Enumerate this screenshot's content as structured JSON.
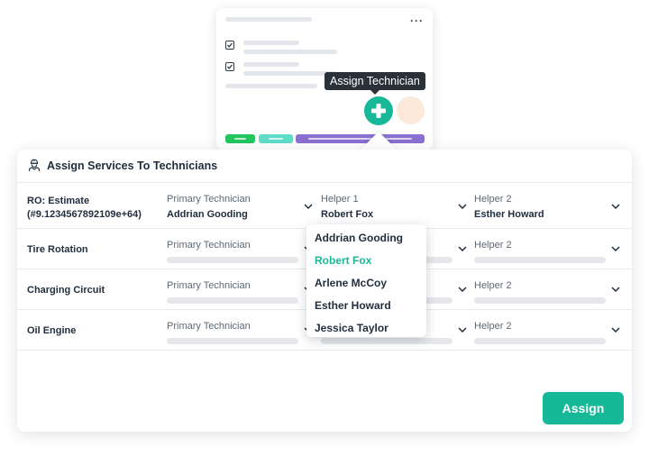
{
  "tooltip": {
    "text": "Assign Technician"
  },
  "back_card": {
    "chip_colors": [
      "#22c55e",
      "#5fdcc8",
      "#8b6fd1"
    ]
  },
  "panel": {
    "title": "Assign Services To Technicians",
    "assign_label": "Assign"
  },
  "rows": [
    {
      "service_line1": "RO: Estimate",
      "service_line2": "(#9.1234567892109e+64)",
      "primary": {
        "label": "Primary Technician",
        "value": "Addrian Gooding"
      },
      "helper1": {
        "label": "Helper 1",
        "value": "Robert Fox"
      },
      "helper2": {
        "label": "Helper 2",
        "value": "Esther Howard"
      }
    },
    {
      "service": "Tire Rotation",
      "primary": {
        "label": "Primary Technician"
      },
      "helper2": {
        "label": "Helper 2"
      }
    },
    {
      "service": "Charging Circuit",
      "primary": {
        "label": "Primary Technician"
      },
      "helper2": {
        "label": "Helper 2"
      }
    },
    {
      "service": "Oil Engine",
      "primary": {
        "label": "Primary Technician"
      },
      "helper2": {
        "label": "Helper 2"
      }
    }
  ],
  "dropdown": {
    "items": [
      "Addrian Gooding",
      "Robert Fox",
      "Arlene McCoy",
      "Esther Howard",
      "Jessica Taylor"
    ],
    "selected": "Robert Fox"
  },
  "colors": {
    "accent": "#17b898",
    "text": "#1f2d3d"
  }
}
